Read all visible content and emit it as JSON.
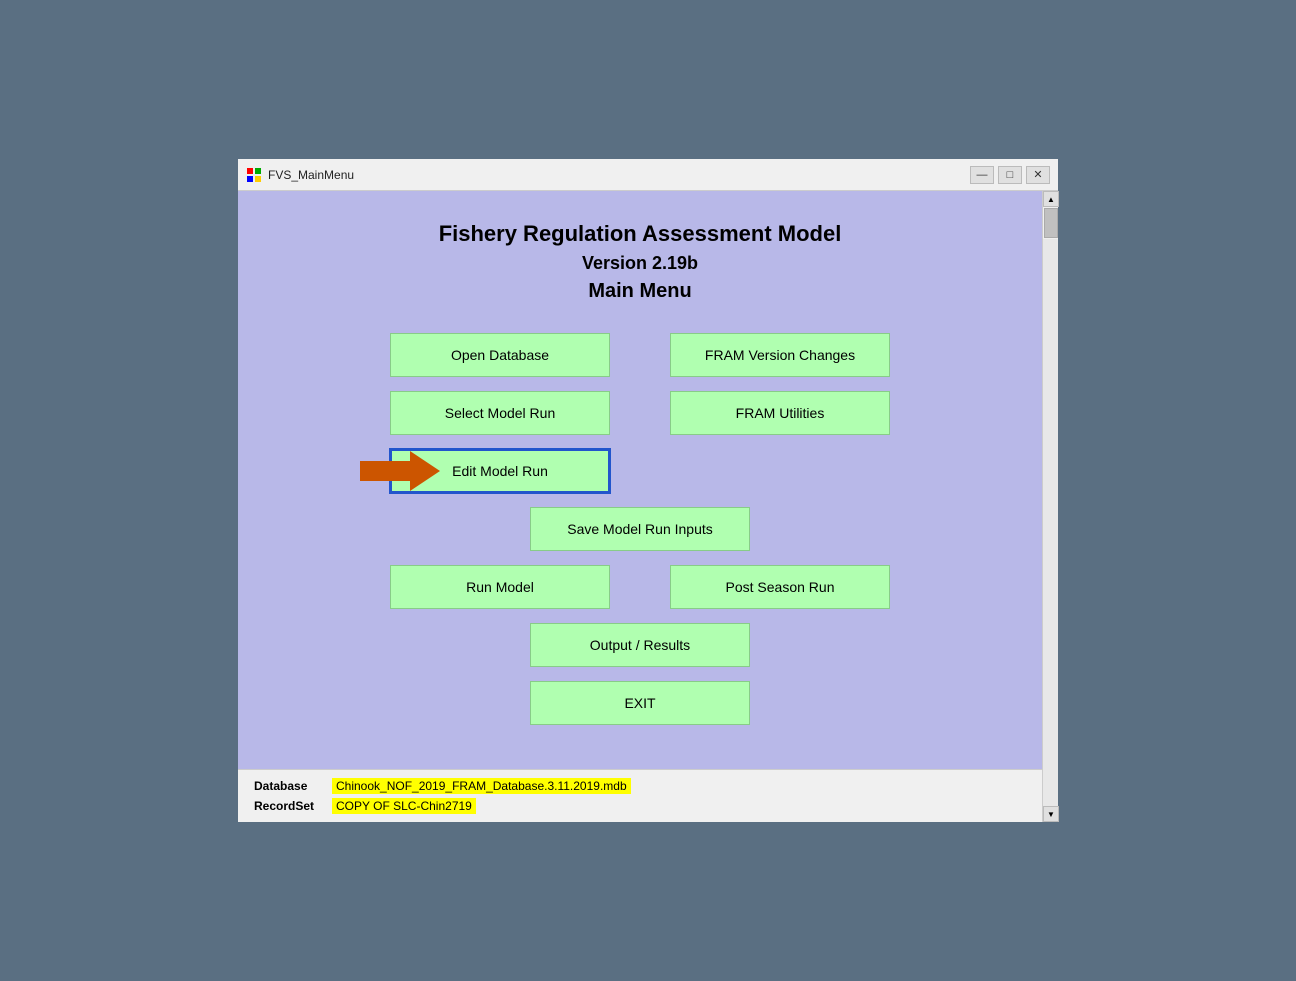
{
  "window": {
    "title": "FVS_MainMenu",
    "title_icon": "grid-icon"
  },
  "titlebar": {
    "minimize_label": "—",
    "restore_label": "□",
    "close_label": "✕"
  },
  "header": {
    "app_title": "Fishery Regulation Assessment Model",
    "version": "Version 2.19b",
    "menu_title": "Main Menu"
  },
  "buttons": {
    "open_database": "Open Database",
    "select_model_run": "Select Model Run",
    "edit_model_run": "Edit Model Run",
    "save_model_run_inputs": "Save Model Run Inputs",
    "run_model": "Run Model",
    "output_results": "Output / Results",
    "exit": "EXIT",
    "fram_version_changes": "FRAM Version Changes",
    "fram_utilities": "FRAM Utilities",
    "post_season_run": "Post Season Run"
  },
  "status": {
    "database_label": "Database",
    "database_value": "Chinook_NOF_2019_FRAM_Database.3.11.2019.mdb",
    "recordset_label": "RecordSet",
    "recordset_value": "COPY OF SLC-Chin2719"
  }
}
